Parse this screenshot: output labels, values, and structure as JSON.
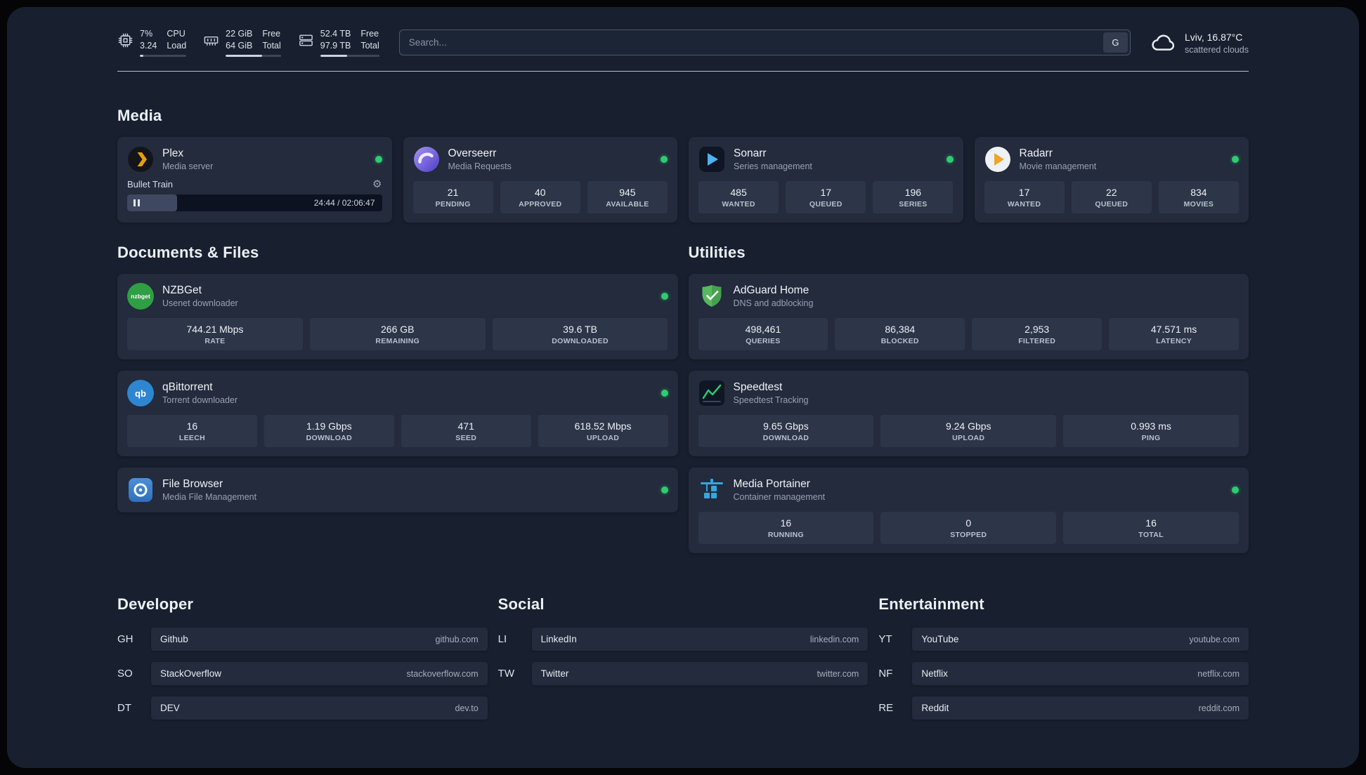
{
  "header": {
    "cpu": {
      "line1": "7%",
      "line2": "3.24",
      "label1": "CPU",
      "label2": "Load",
      "bar_percent": "7%"
    },
    "ram": {
      "line1": "22 GiB",
      "line2": "64 GiB",
      "label1": "Free",
      "label2": "Total",
      "bar_percent": "66%"
    },
    "disk": {
      "line1": "52.4 TB",
      "line2": "97.9 TB",
      "label1": "Free",
      "label2": "Total",
      "bar_percent": "46%"
    },
    "search": {
      "placeholder": "Search...",
      "button_label": "G"
    },
    "weather": {
      "location": "Lviv, 16.87°C",
      "condition": "scattered clouds"
    }
  },
  "sections": {
    "media": {
      "title": "Media",
      "apps": [
        {
          "name": "Plex",
          "description": "Media server",
          "player": {
            "track": "Bullet Train",
            "time": "24:44 / 02:06:47",
            "progress_percent": "19.5%"
          }
        },
        {
          "name": "Overseerr",
          "description": "Media Requests",
          "stats": [
            {
              "value": "21",
              "label": "PENDING"
            },
            {
              "value": "40",
              "label": "APPROVED"
            },
            {
              "value": "945",
              "label": "AVAILABLE"
            }
          ]
        },
        {
          "name": "Sonarr",
          "description": "Series management",
          "stats": [
            {
              "value": "485",
              "label": "WANTED"
            },
            {
              "value": "17",
              "label": "QUEUED"
            },
            {
              "value": "196",
              "label": "SERIES"
            }
          ]
        },
        {
          "name": "Radarr",
          "description": "Movie management",
          "stats": [
            {
              "value": "17",
              "label": "WANTED"
            },
            {
              "value": "22",
              "label": "QUEUED"
            },
            {
              "value": "834",
              "label": "MOVIES"
            }
          ]
        }
      ]
    },
    "documents": {
      "title": "Documents & Files",
      "apps": [
        {
          "name": "NZBGet",
          "description": "Usenet downloader",
          "stats": [
            {
              "value": "744.21 Mbps",
              "label": "RATE"
            },
            {
              "value": "266 GB",
              "label": "REMAINING"
            },
            {
              "value": "39.6 TB",
              "label": "DOWNLOADED"
            }
          ]
        },
        {
          "name": "qBittorrent",
          "description": "Torrent downloader",
          "stats": [
            {
              "value": "16",
              "label": "LEECH"
            },
            {
              "value": "1.19 Gbps",
              "label": "DOWNLOAD"
            },
            {
              "value": "471",
              "label": "SEED"
            },
            {
              "value": "618.52 Mbps",
              "label": "UPLOAD"
            }
          ]
        },
        {
          "name": "File Browser",
          "description": "Media File Management"
        }
      ]
    },
    "utilities": {
      "title": "Utilities",
      "apps": [
        {
          "name": "AdGuard Home",
          "description": "DNS and adblocking",
          "stats": [
            {
              "value": "498,461",
              "label": "QUERIES"
            },
            {
              "value": "86,384",
              "label": "BLOCKED"
            },
            {
              "value": "2,953",
              "label": "FILTERED"
            },
            {
              "value": "47.571 ms",
              "label": "LATENCY"
            }
          ]
        },
        {
          "name": "Speedtest",
          "description": "Speedtest Tracking",
          "stats": [
            {
              "value": "9.65 Gbps",
              "label": "DOWNLOAD"
            },
            {
              "value": "9.24 Gbps",
              "label": "UPLOAD"
            },
            {
              "value": "0.993 ms",
              "label": "PING"
            }
          ]
        },
        {
          "name": "Media Portainer",
          "description": "Container management",
          "stats": [
            {
              "value": "16",
              "label": "RUNNING"
            },
            {
              "value": "0",
              "label": "STOPPED"
            },
            {
              "value": "16",
              "label": "TOTAL"
            }
          ]
        }
      ]
    }
  },
  "bookmarks": [
    {
      "title": "Developer",
      "items": [
        {
          "abbr": "GH",
          "name": "Github",
          "url": "github.com"
        },
        {
          "abbr": "SO",
          "name": "StackOverflow",
          "url": "stackoverflow.com"
        },
        {
          "abbr": "DT",
          "name": "DEV",
          "url": "dev.to"
        }
      ]
    },
    {
      "title": "Social",
      "items": [
        {
          "abbr": "LI",
          "name": "LinkedIn",
          "url": "linkedin.com"
        },
        {
          "abbr": "TW",
          "name": "Twitter",
          "url": "twitter.com"
        }
      ]
    },
    {
      "title": "Entertainment",
      "items": [
        {
          "abbr": "YT",
          "name": "YouTube",
          "url": "youtube.com"
        },
        {
          "abbr": "NF",
          "name": "Netflix",
          "url": "netflix.com"
        },
        {
          "abbr": "RE",
          "name": "Reddit",
          "url": "reddit.com"
        }
      ]
    }
  ],
  "colors": {
    "status_online": "#2ecc71"
  }
}
